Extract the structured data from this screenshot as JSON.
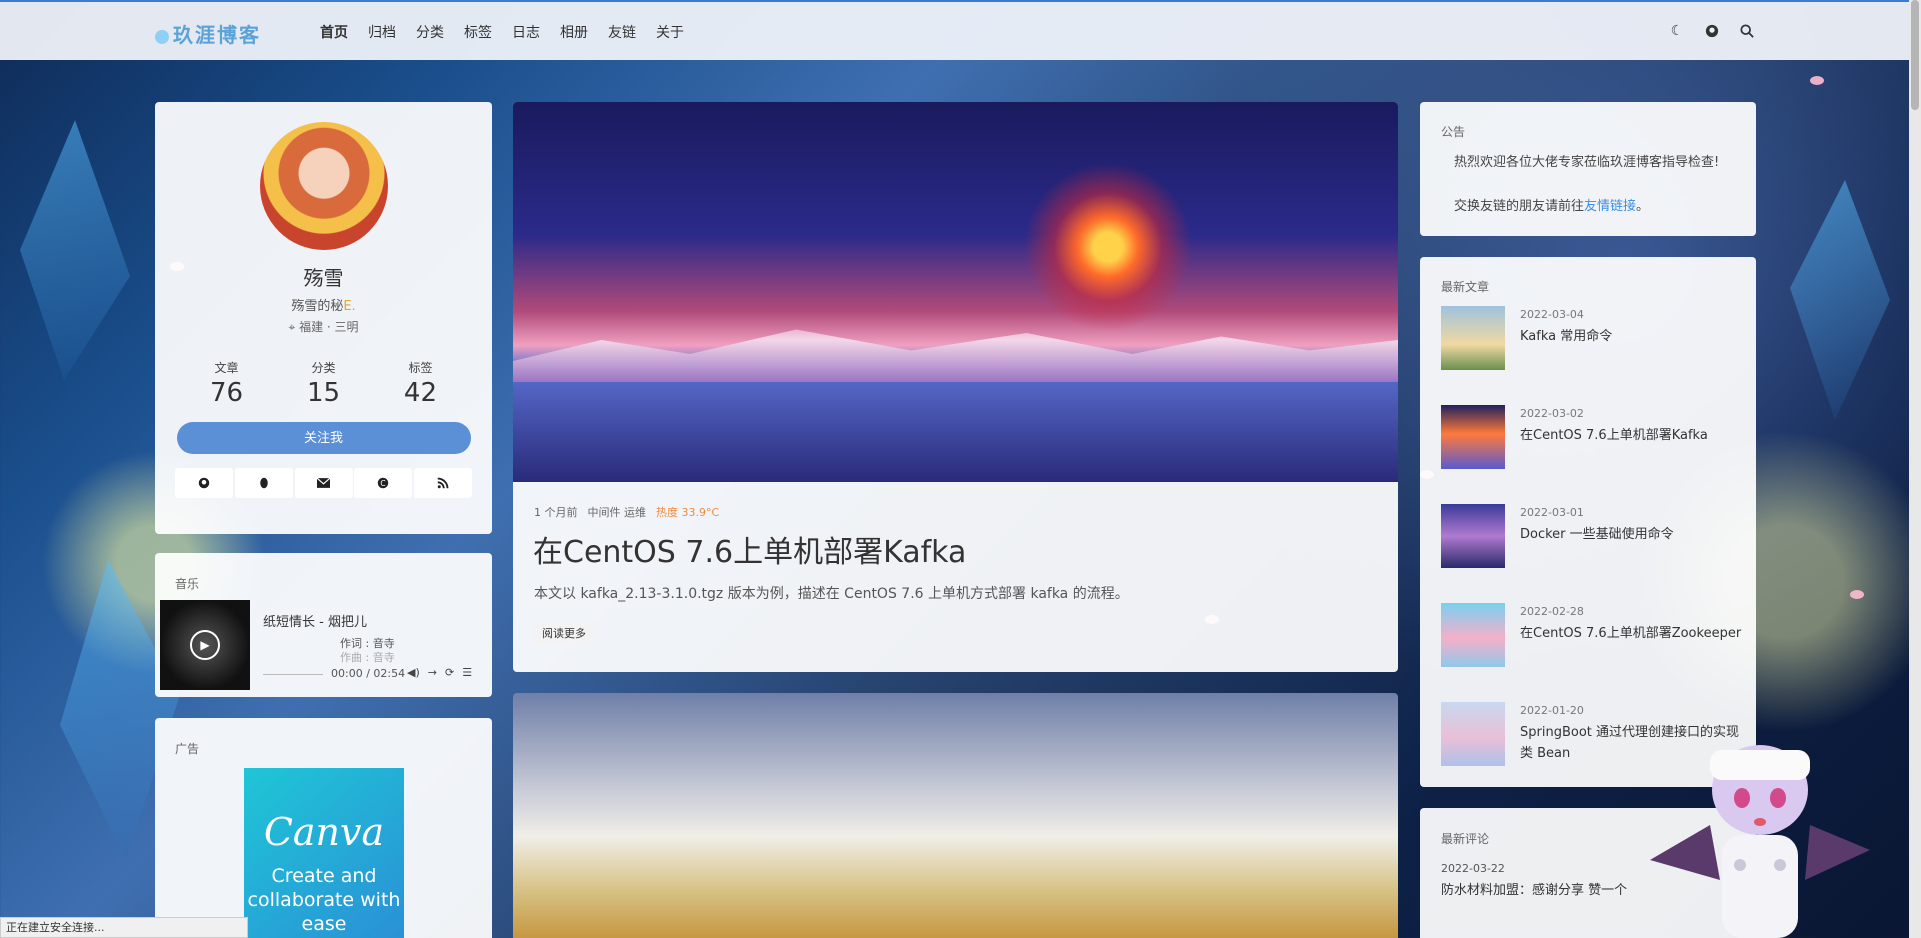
{
  "nav": {
    "logo": "玖涯博客",
    "menu": [
      "首页",
      "归档",
      "分类",
      "标签",
      "日志",
      "相册",
      "友链",
      "关于"
    ],
    "icons": [
      "moon-icon",
      "github-icon",
      "search-icon"
    ]
  },
  "author": {
    "name": "殇雪",
    "desc_text": "殇雪的秘",
    "desc_highlight": "E.",
    "location": "福建 · 三明",
    "stats": [
      {
        "label": "文章",
        "value": "76"
      },
      {
        "label": "分类",
        "value": "15"
      },
      {
        "label": "标签",
        "value": "42"
      }
    ],
    "follow_label": "关注我",
    "socials": [
      "github-icon",
      "qq-icon",
      "mail-icon",
      "csdn-icon",
      "rss-icon"
    ]
  },
  "music": {
    "label": "音乐",
    "track": "纸短情长 - 烟把儿",
    "lyric_line1": "作词 : 音寺",
    "lyric_line2": "作曲 : 音寺",
    "time": "00:00 / 02:54",
    "progress": 0
  },
  "ad": {
    "label": "广告",
    "brand": "Canva",
    "tagline": "Create and collaborate with ease"
  },
  "post": {
    "time_ago": "1 个月前",
    "tags": "中间件 运维",
    "heat": "热度 33.9°C",
    "title": "在CentOS 7.6上单机部署Kafka",
    "excerpt": "本文以 kafka_2.13-3.1.0.tgz 版本为例，描述在 CentOS 7.6 上单机方式部署 kafka 的流程。",
    "read_more": "阅读更多"
  },
  "notice": {
    "label": "公告",
    "line1": "热烈欢迎各位大佬专家莅临玖涯博客指导检查!",
    "line2_prefix": "交换友链的朋友请前往",
    "line2_link": "友情链接",
    "line2_suffix": "。"
  },
  "recent": {
    "label": "最新文章",
    "items": [
      {
        "date": "2022-03-04",
        "title": "Kafka 常用命令"
      },
      {
        "date": "2022-03-02",
        "title": "在CentOS 7.6上单机部署Kafka"
      },
      {
        "date": "2022-03-01",
        "title": "Docker 一些基础使用命令"
      },
      {
        "date": "2022-02-28",
        "title": "在CentOS 7.6上单机部署Zookeeper"
      },
      {
        "date": "2022-01-20",
        "title": "SpringBoot 通过代理创建接口的实现类 Bean"
      }
    ]
  },
  "comments": {
    "label": "最新评论",
    "date": "2022-03-22",
    "text": "防水材料加盟：感谢分享 赞一个"
  },
  "status": "正在建立安全连接..."
}
